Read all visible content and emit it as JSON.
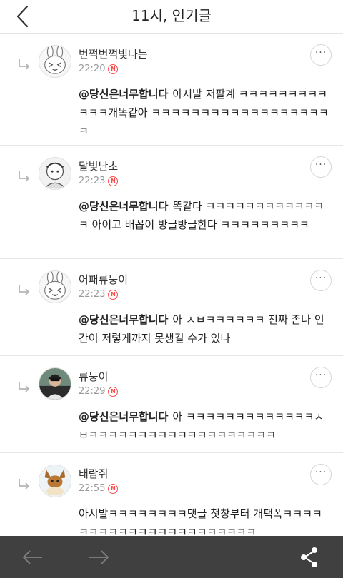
{
  "header": {
    "title": "11시, 인기글",
    "back_icon": "chevron-left-icon"
  },
  "colors": {
    "new_badge": "#ff4a4a",
    "bottom_bar": "#404040",
    "divider": "#e6e6e6"
  },
  "comments": [
    {
      "username": "번쩍번쩍빛나는",
      "time": "22:20",
      "new_badge": "N",
      "avatar": "bunny-avatar",
      "mention": "@당신은너무합니다",
      "text": "아시발 저팔계 ㅋㅋㅋㅋㅋㅋㅋㅋㅋㅋㅋㅋ개똑같아 ㅋㅋㅋㅋㅋㅋㅋㅋㅋㅋㅋㅋㅋㅋㅋㅋㅋㅋㅋ",
      "more_label": "···"
    },
    {
      "username": "달빛난초",
      "time": "22:23",
      "new_badge": "N",
      "avatar": "sketch-avatar",
      "mention": "@당신은너무합니다",
      "text": "똑같다 ㅋㅋㅋㅋㅋㅋㅋㅋㅋㅋㅋㅋㅋ 아이고 배꼽이 방글방글한다 ㅋㅋㅋㅋㅋㅋㅋㅋㅋ",
      "more_label": "···"
    },
    {
      "username": "어패류둥이",
      "time": "22:23",
      "new_badge": "N",
      "avatar": "bunny-avatar",
      "mention": "@당신은너무합니다",
      "text": "아 ㅅㅂㅋㅋㅋㅋㅋㅋ 진짜 존나 인간이 저렇게까지 못생길 수가 있나",
      "more_label": "···"
    },
    {
      "username": "류둥이",
      "time": "22:29",
      "new_badge": "N",
      "avatar": "photo-avatar",
      "mention": "@당신은너무합니다",
      "text": "아 ㅋㅋㅋㅋㅋㅋㅋㅋㅋㅋㅋㅋㅋㅅㅂㅋㅋㅋㅋㅋㅋㅋㅋㅋㅋㅋㅋㅋㅋㅋㅋㅋㅋㅋ",
      "more_label": "···"
    },
    {
      "username": "태람쥐",
      "time": "22:55",
      "new_badge": "N",
      "avatar": "eevee-avatar",
      "mention": "",
      "text": "아시발ㅋㅋㅋㅋㅋㅋㅋㅋ댓글 첫창부터 개팩폭ㅋㅋㅋㅋㅋㅋㅋㅋㅋㅋㅋㅋㅋㅋㅋㅋㅋㅋㅋㅋㅋㅋ",
      "more_label": "···"
    }
  ],
  "bottom_bar": {
    "back_icon": "arrow-left-icon",
    "forward_icon": "arrow-right-icon",
    "share_icon": "share-icon"
  }
}
